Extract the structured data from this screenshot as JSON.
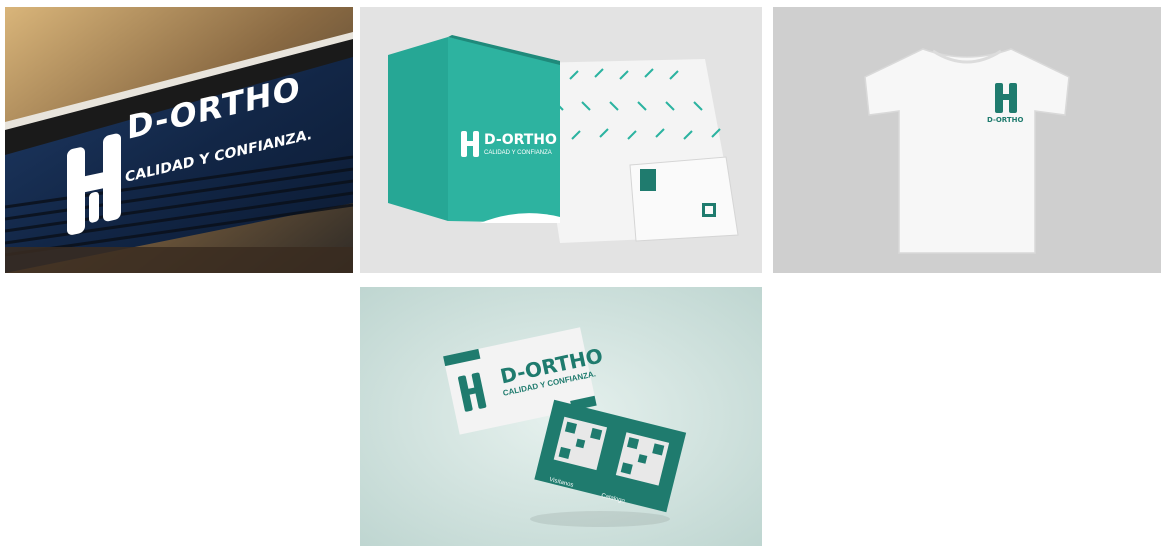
{
  "brand": {
    "name": "D-ORTHO",
    "tagline": "CALIDAD Y CONFIANZA.",
    "tagline_folder": "CALIDAD Y CONFIANZA",
    "tagline_card": "CALIDAD Y CONFIANZA."
  },
  "card_back": {
    "qr_left_label": "Visítanos",
    "qr_right_label": "Catalogo"
  },
  "colors": {
    "teal": "#25a08f",
    "dark_teal": "#1f7b6e",
    "sign_navy": "#16294a",
    "white": "#ffffff"
  },
  "icons": [
    "logo-h-tooth-icon",
    "qr-code-icon"
  ]
}
